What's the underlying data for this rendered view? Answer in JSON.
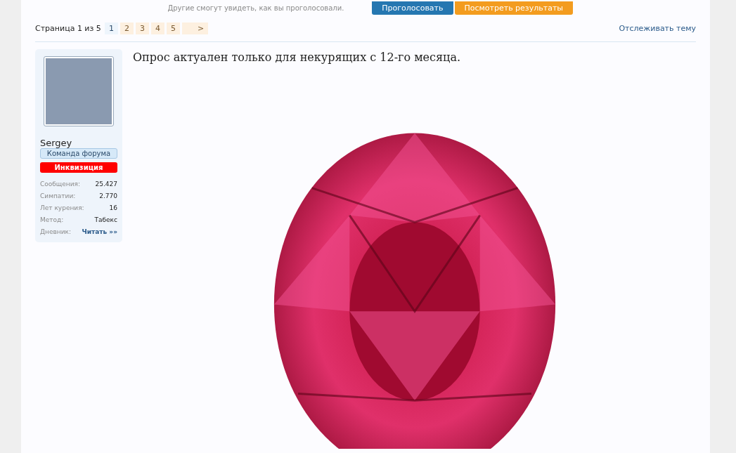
{
  "poll": {
    "hint": "Другие смогут увидеть, как вы проголосовали.",
    "buttons": [
      {
        "label": "Проголосовать",
        "kind": "primary"
      },
      {
        "label": "Посмотреть результаты",
        "kind": "secondary"
      }
    ]
  },
  "pagination": {
    "label": "Страница 1 из 5",
    "pages": [
      {
        "label": "1",
        "selected": true
      },
      {
        "label": "2",
        "selected": false
      },
      {
        "label": "3",
        "selected": false
      },
      {
        "label": "4",
        "selected": false
      },
      {
        "label": "5",
        "selected": false
      }
    ],
    "next": ">"
  },
  "watch_link": "Отслеживать тему",
  "author": {
    "name": "Sergey",
    "title": "Команда форума",
    "badge": "Инквизиция",
    "stats": [
      {
        "label": "Сообщения:",
        "value": "25.427",
        "kind": "text"
      },
      {
        "label": "Симпатии:",
        "value": "2.770",
        "kind": "text"
      },
      {
        "label": "Лет курения:",
        "value": "16",
        "kind": "text"
      },
      {
        "label": "Метод:",
        "value": "Табекс",
        "kind": "text"
      },
      {
        "label": "Дневник:",
        "value": "Читать »»",
        "kind": "link"
      }
    ]
  },
  "post": {
    "text": "Опрос актуален только для некурящих с 12-го месяца."
  }
}
